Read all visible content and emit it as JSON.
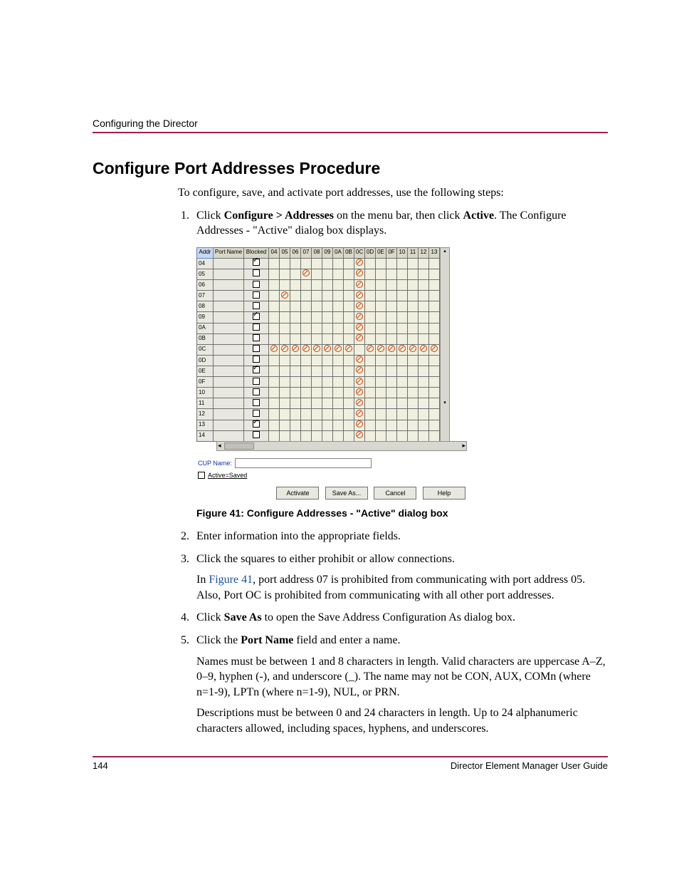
{
  "header": {
    "running": "Configuring the Director"
  },
  "title": "Configure Port Addresses Procedure",
  "intro": "To configure, save, and activate port addresses, use the following steps:",
  "steps": {
    "s1_a": "Click ",
    "s1_b": "Configure > Addresses",
    "s1_c": " on the menu bar, then click ",
    "s1_d": "Active",
    "s1_e": ". The Configure Addresses - \"Active\" dialog box displays.",
    "s2": "Enter information into the appropriate fields.",
    "s3": "Click the squares to either prohibit or allow connections.",
    "s3_p_a": "In ",
    "s3_p_link": "Figure 41",
    "s3_p_b": ", port address 07 is prohibited from communicating with port address 05. Also, Port OC is prohibited from communicating with all other port addresses.",
    "s4_a": "Click ",
    "s4_b": "Save As",
    "s4_c": " to open the Save Address Configuration As dialog box.",
    "s5_a": "Click the ",
    "s5_b": "Port Name",
    "s5_c": " field and enter a name.",
    "s5_p1": "Names must be between 1 and 8 characters in length. Valid characters are uppercase A–Z, 0–9, hyphen (-), and underscore (_). The name may not be CON, AUX, COMn (where n=1-9), LPTn (where n=1-9), NUL, or PRN.",
    "s5_p2": "Descriptions must be between 0 and 24 characters in length. Up to 24 alphanumeric characters allowed, including spaces, hyphens, and underscores."
  },
  "figure": {
    "caption": "Figure 41:  Configure Addresses - \"Active\" dialog box",
    "headers": {
      "addr": "Addr",
      "portname": "Port Name",
      "blocked": "Blocked"
    },
    "cols": [
      "04",
      "05",
      "06",
      "07",
      "08",
      "09",
      "0A",
      "0B",
      "0C",
      "0D",
      "0E",
      "0F",
      "10",
      "11",
      "12",
      "13"
    ],
    "rows": [
      {
        "addr": "04",
        "blocked": true,
        "prohibit": [
          "0C"
        ]
      },
      {
        "addr": "05",
        "blocked": false,
        "prohibit": [
          "07",
          "0C"
        ]
      },
      {
        "addr": "06",
        "blocked": false,
        "prohibit": [
          "0C"
        ]
      },
      {
        "addr": "07",
        "blocked": false,
        "prohibit": [
          "05",
          "0C"
        ]
      },
      {
        "addr": "08",
        "blocked": false,
        "prohibit": [
          "0C"
        ]
      },
      {
        "addr": "09",
        "blocked": true,
        "prohibit": [
          "0C"
        ]
      },
      {
        "addr": "0A",
        "blocked": false,
        "prohibit": [
          "0C"
        ]
      },
      {
        "addr": "0B",
        "blocked": false,
        "prohibit": [
          "0C"
        ]
      },
      {
        "addr": "0C",
        "blocked": false,
        "prohibit": [
          "04",
          "05",
          "06",
          "07",
          "08",
          "09",
          "0A",
          "0B",
          "0D",
          "0E",
          "0F",
          "10",
          "11",
          "12",
          "13"
        ]
      },
      {
        "addr": "0D",
        "blocked": false,
        "prohibit": [
          "0C"
        ]
      },
      {
        "addr": "0E",
        "blocked": true,
        "prohibit": [
          "0C"
        ]
      },
      {
        "addr": "0F",
        "blocked": false,
        "prohibit": [
          "0C"
        ]
      },
      {
        "addr": "10",
        "blocked": false,
        "prohibit": [
          "0C"
        ]
      },
      {
        "addr": "11",
        "blocked": false,
        "prohibit": [
          "0C"
        ]
      },
      {
        "addr": "12",
        "blocked": false,
        "prohibit": [
          "0C"
        ]
      },
      {
        "addr": "13",
        "blocked": true,
        "prohibit": [
          "0C"
        ]
      },
      {
        "addr": "14",
        "blocked": false,
        "prohibit": [
          "0C"
        ]
      }
    ],
    "cup_label": "CUP Name:",
    "active_saved": "Active=Saved",
    "buttons": {
      "activate": "Activate",
      "saveas": "Save As...",
      "cancel": "Cancel",
      "help": "Help"
    }
  },
  "footer": {
    "page": "144",
    "book": "Director Element Manager User Guide"
  }
}
